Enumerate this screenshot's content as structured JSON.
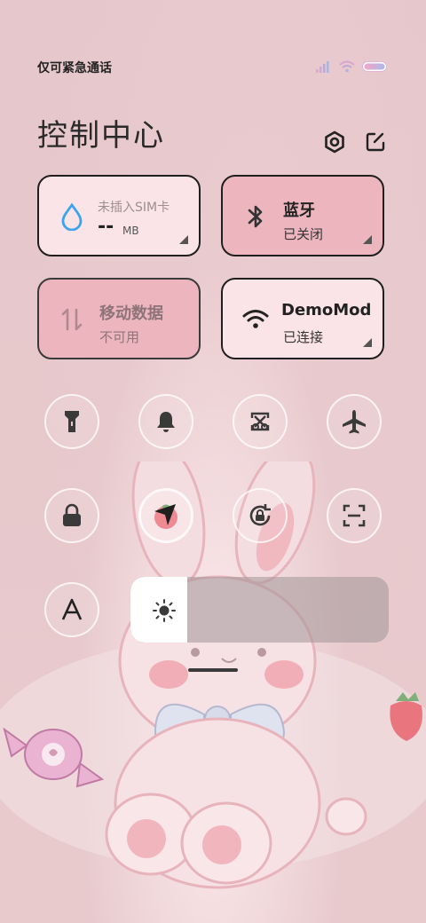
{
  "status_bar": {
    "carrier_text": "仅可紧急通话"
  },
  "header": {
    "title": "控制中心"
  },
  "tiles": {
    "data_usage": {
      "label": "未插入SIM卡",
      "value": "--",
      "unit": "MB"
    },
    "bluetooth": {
      "title": "蓝牙",
      "status": "已关闭"
    },
    "mobile_data": {
      "title": "移动数据",
      "status": "不可用"
    },
    "wifi": {
      "title": "DemoMod",
      "status": "已连接"
    }
  },
  "toggles": [
    "flashlight-icon",
    "bell-icon",
    "screenshot-icon",
    "airplane-icon",
    "lock-icon",
    "location-icon",
    "rotation-lock-icon",
    "scan-icon",
    "font-icon"
  ],
  "brightness": {
    "level": 0.22
  },
  "colors": {
    "accent_pink": "#edb6be",
    "tile_light": "#fbe4e7",
    "drop_blue": "#3aa4f0"
  }
}
